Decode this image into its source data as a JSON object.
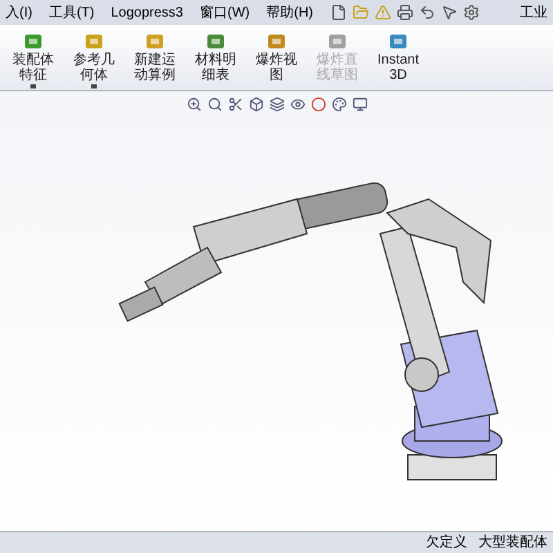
{
  "menu": [
    "入(I)",
    "工具(T)",
    "Logopress3",
    "窗口(W)",
    "帮助(H)"
  ],
  "title": "工业",
  "toolbar": [
    {
      "label": "装配体特征",
      "dropdown": true,
      "disabled": false
    },
    {
      "label": "参考几何体",
      "dropdown": true,
      "disabled": false
    },
    {
      "label": "新建运动算例",
      "dropdown": false,
      "disabled": false
    },
    {
      "label": "材料明细表",
      "dropdown": false,
      "disabled": false
    },
    {
      "label": "爆炸视图",
      "dropdown": false,
      "disabled": false
    },
    {
      "label": "爆炸直线草图",
      "dropdown": false,
      "disabled": true
    },
    {
      "label": "Instant3D",
      "dropdown": false,
      "disabled": false
    }
  ],
  "status_bar": [
    "欠定义",
    "大型装配体"
  ]
}
